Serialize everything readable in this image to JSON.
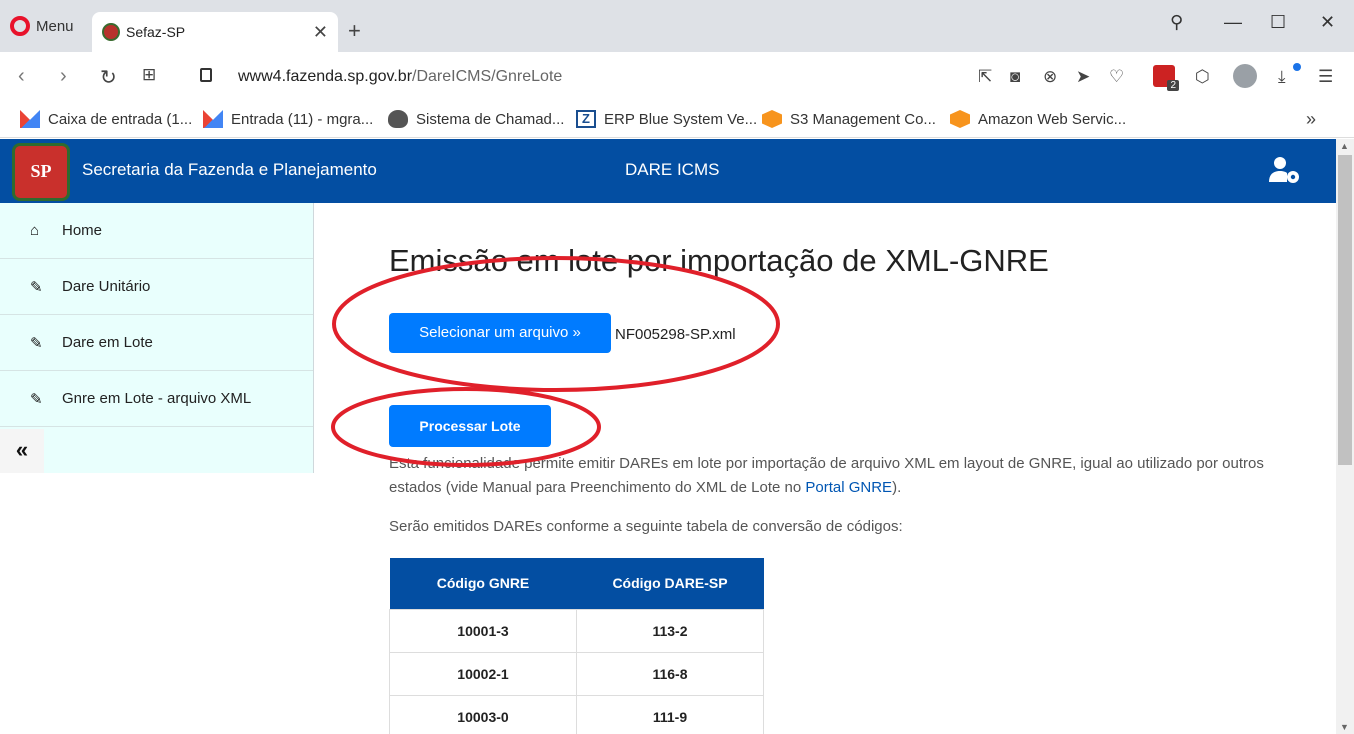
{
  "browser": {
    "menu_label": "Menu",
    "tab_title": "Sefaz-SP",
    "url_domain": "www4.fazenda.sp.gov.br",
    "url_path": "/DareICMS/GnreLote",
    "extension_badge": "2",
    "bookmarks": [
      {
        "label": "Caixa de entrada (1...",
        "icon": "gmail-icon"
      },
      {
        "label": "Entrada (11) - mgra...",
        "icon": "gmail-icon"
      },
      {
        "label": "Sistema de Chamad...",
        "icon": "bug-icon"
      },
      {
        "label": "ERP Blue System Ve...",
        "icon": "z-icon"
      },
      {
        "label": "S3 Management Co...",
        "icon": "aws-cube-icon"
      },
      {
        "label": "Amazon Web Servic...",
        "icon": "aws-cube-icon"
      }
    ]
  },
  "header": {
    "logo_text": "SP",
    "title": "Secretaria da Fazenda e Planejamento",
    "center": "DARE ICMS"
  },
  "sidebar": {
    "items": [
      {
        "label": "Home",
        "icon": "home-icon"
      },
      {
        "label": "Dare Unitário",
        "icon": "edit-icon"
      },
      {
        "label": "Dare em Lote",
        "icon": "edit-icon"
      },
      {
        "label": "Gnre em Lote - arquivo XML",
        "icon": "edit-icon"
      }
    ],
    "collapse_label": "«"
  },
  "main": {
    "title": "Emissão em lote por importação de XML-GNRE",
    "select_file_label": "Selecionar um arquivo »",
    "file_name": "NF005298-SP.xml",
    "process_label": "Processar Lote",
    "description_prefix": "Esta funcionalidade permite emitir DAREs em lote por importação de arquivo XML em layout de GNRE, igual ao utilizado por outros estados (vide Manual para Preenchimento do XML de Lote no ",
    "description_link": "Portal GNRE",
    "description_suffix": ").",
    "table_intro": "Serão emitidos DAREs conforme a seguinte tabela de conversão de códigos:",
    "table": {
      "headers": [
        "Código GNRE",
        "Código DARE-SP"
      ],
      "rows": [
        [
          "10001-3",
          "113-2"
        ],
        [
          "10002-1",
          "116-8"
        ],
        [
          "10003-0",
          "111-9"
        ]
      ]
    }
  },
  "colors": {
    "header_blue": "#034ea2",
    "button_blue": "#007bff",
    "sidebar_bg": "#e9fffd",
    "annotation_red": "#e0202a"
  }
}
